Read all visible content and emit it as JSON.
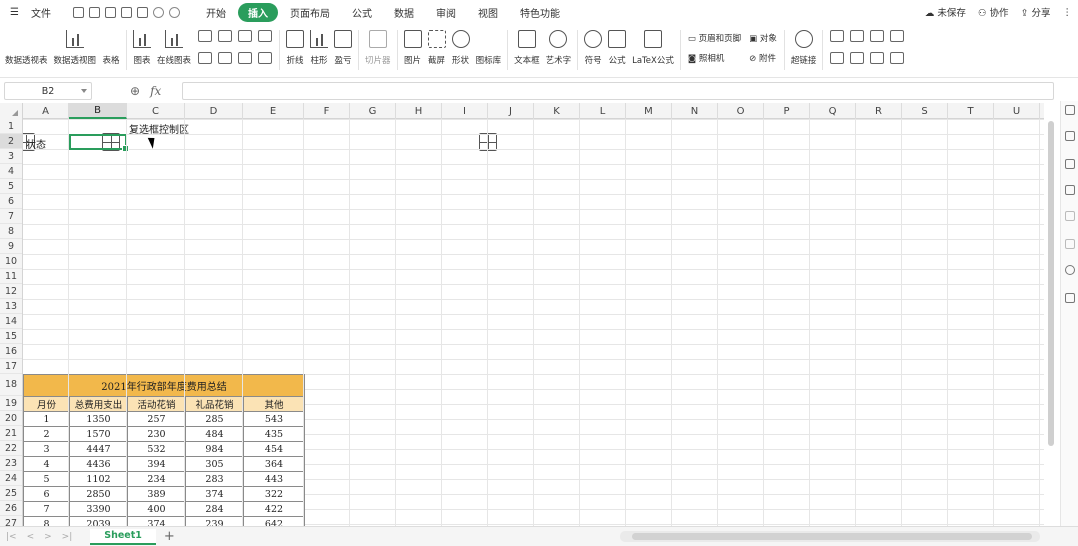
{
  "menubar": {
    "menu_icon": "hamburger-icon",
    "file_label": "文件",
    "tabs": [
      "开始",
      "插入",
      "页面布局",
      "公式",
      "数据",
      "审阅",
      "视图",
      "特色功能"
    ],
    "active_tab": "插入",
    "right": {
      "unsaved": "未保存",
      "collaborate": "协作",
      "share": "分享"
    }
  },
  "ribbon": {
    "pivot_table": "数据透视表",
    "pivot_chart": "数据透视图",
    "table": "表格",
    "chart": "图表",
    "online_chart": "在线图表",
    "line": "折线",
    "column": "柱形",
    "win_loss": "盈亏",
    "slicer": "切片器",
    "picture": "图片",
    "screenshot": "截屏",
    "shapes": "形状",
    "icon_library": "图标库",
    "textbox": "文本框",
    "wordart": "艺术字",
    "symbol": "符号",
    "formula": "公式",
    "latex": "LaTeX公式",
    "header_footer": "页眉和页脚",
    "camera": "照相机",
    "object": "对象",
    "attachment": "附件",
    "hyperlink": "超链接"
  },
  "formula_bar": {
    "cell_ref": "B2",
    "fx_label": "fx",
    "value": ""
  },
  "columns": [
    "A",
    "B",
    "C",
    "D",
    "E",
    "F",
    "G",
    "H",
    "I",
    "J",
    "K",
    "L",
    "M",
    "N",
    "O",
    "P",
    "Q",
    "R",
    "S",
    "T",
    "U"
  ],
  "selected_column": "B",
  "rows": [
    "1",
    "2",
    "3",
    "4",
    "5",
    "6",
    "7",
    "8",
    "9",
    "10",
    "11",
    "12",
    "13",
    "14",
    "15",
    "16",
    "17",
    "18",
    "19",
    "20",
    "21",
    "22",
    "23",
    "24",
    "25",
    "26",
    "27"
  ],
  "selected_row": "2",
  "cells": {
    "c1": "复选框控制区",
    "a2": "状态"
  },
  "expense_table": {
    "title": "2021年行政部年度费用总结",
    "headers": [
      "月份",
      "总费用支出",
      "活动花销",
      "礼品花销",
      "其他"
    ],
    "rows": [
      [
        "1",
        "1350",
        "257",
        "285",
        "543"
      ],
      [
        "2",
        "1570",
        "230",
        "484",
        "435"
      ],
      [
        "3",
        "4447",
        "532",
        "984",
        "454"
      ],
      [
        "4",
        "4436",
        "394",
        "305",
        "364"
      ],
      [
        "5",
        "1102",
        "234",
        "283",
        "443"
      ],
      [
        "6",
        "2850",
        "389",
        "374",
        "322"
      ],
      [
        "7",
        "3390",
        "400",
        "284",
        "422"
      ],
      [
        "8",
        "2039",
        "374",
        "239",
        "642"
      ]
    ]
  },
  "sheets": [
    "Sheet1"
  ],
  "add_sheet": "+",
  "colors": {
    "accent": "#2a9d5c",
    "title_fill": "#f2b84b",
    "header_fill": "#fbe3b5"
  }
}
